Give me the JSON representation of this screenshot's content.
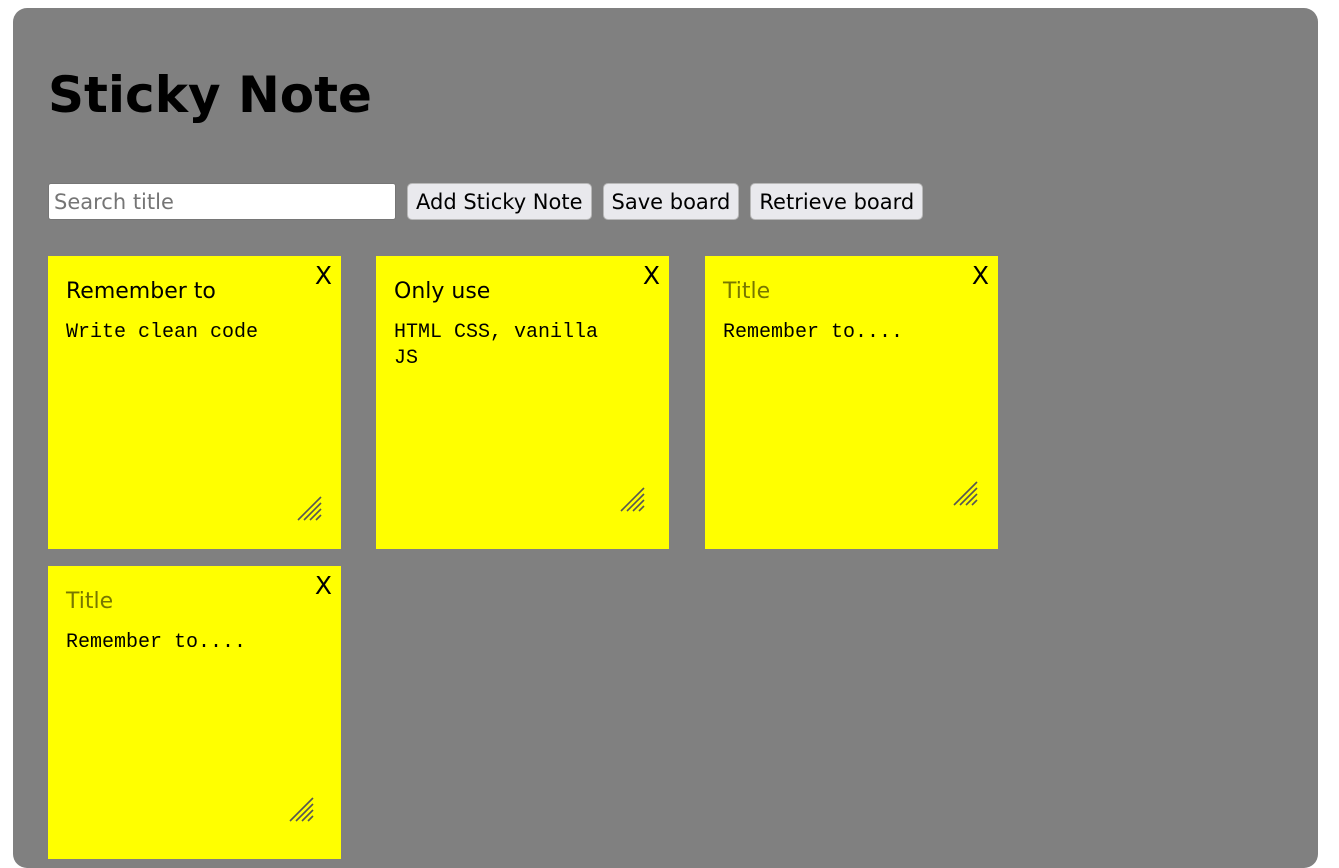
{
  "header": {
    "title": "Sticky Note"
  },
  "toolbar": {
    "search_placeholder": "Search title",
    "search_value": "",
    "add_label": "Add Sticky Note",
    "save_label": "Save board",
    "retrieve_label": "Retrieve board"
  },
  "notes": [
    {
      "title": "Remember to",
      "title_is_placeholder": false,
      "body": "Write clean code",
      "close": "X"
    },
    {
      "title": "Only use",
      "title_is_placeholder": false,
      "body": "HTML CSS, vanilla\nJS",
      "close": "X"
    },
    {
      "title": "Title",
      "title_is_placeholder": true,
      "body": "Remember to....",
      "close": "X"
    },
    {
      "title": "Title",
      "title_is_placeholder": true,
      "body": "Remember to....",
      "close": "X"
    }
  ],
  "colors": {
    "board": "#808080",
    "note": "#ffff00",
    "button": "#e9e9ed"
  }
}
